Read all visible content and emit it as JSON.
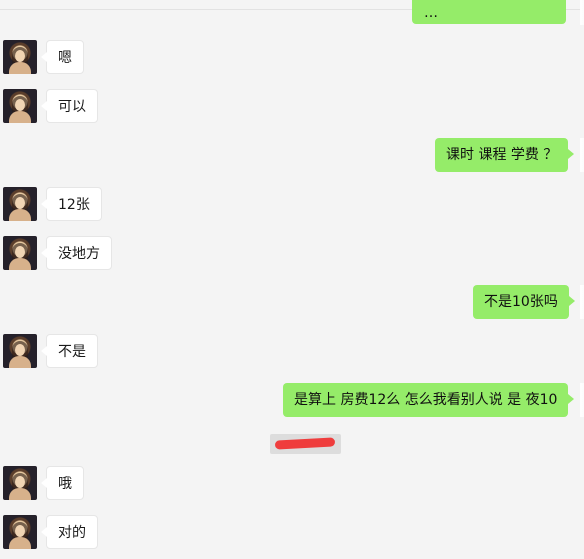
{
  "conversation": {
    "messages": [
      {
        "side": "in",
        "text": "嗯"
      },
      {
        "side": "in",
        "text": "可以"
      },
      {
        "side": "out",
        "text": "课时 课程 学费 ？"
      },
      {
        "side": "in",
        "text": "12张"
      },
      {
        "side": "in",
        "text": "没地方"
      },
      {
        "side": "out",
        "text": "不是10张吗"
      },
      {
        "side": "in",
        "text": "不是"
      },
      {
        "side": "out",
        "text": "是算上 房费12么  怎么我看别人说 是 夜10"
      },
      {
        "side": "in",
        "text": "哦"
      },
      {
        "side": "in",
        "text": "对的"
      }
    ],
    "partial_top_text": "…"
  },
  "style": {
    "incoming_bubble": "#ffffff",
    "outgoing_bubble": "#95ec69",
    "background": "#f4f4f4",
    "redaction": "#ef3d3d"
  }
}
